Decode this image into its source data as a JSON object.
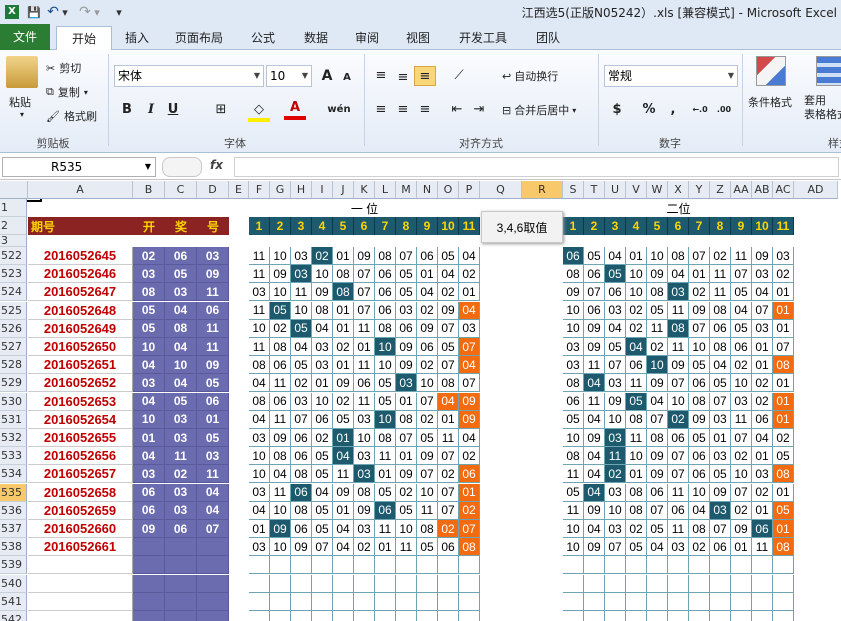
{
  "window": {
    "title": "江西选5(正版N05242）.xls  [兼容模式]  -  Microsoft Excel"
  },
  "qat": {
    "save": "💾",
    "undo": "↶",
    "undo_drop": "▾",
    "redo": "↷",
    "redo_drop": "▾",
    "customize": "▾"
  },
  "tabs": [
    "文件",
    "开始",
    "插入",
    "页面布局",
    "公式",
    "数据",
    "审阅",
    "视图",
    "开发工具",
    "团队"
  ],
  "ribbon": {
    "clipboard": {
      "label": "剪贴板",
      "paste": "粘贴",
      "cut": "剪切",
      "copy": "复制",
      "painter": "格式刷"
    },
    "font": {
      "label": "字体",
      "name": "宋体",
      "size": "10",
      "bold": "B",
      "italic": "I",
      "underline": "U",
      "grow": "A",
      "shrink": "A",
      "color": "A",
      "wen": "wén"
    },
    "align": {
      "label": "对齐方式",
      "wrap": "自动换行",
      "merge": "合并后居中"
    },
    "number": {
      "label": "数字",
      "format": "常规",
      "currency": "$",
      "percent": "%",
      "comma": ",",
      "inc": "←.0",
      "dec": ".00"
    },
    "styles": {
      "cond": "条件格式",
      "table": "套用\n表格格式",
      "cell": "样式"
    }
  },
  "formula_bar": {
    "name_box": "R535",
    "fx": "fx",
    "value": ""
  },
  "columns": [
    "A",
    "B",
    "C",
    "D",
    "E",
    "F",
    "G",
    "H",
    "I",
    "J",
    "K",
    "L",
    "M",
    "N",
    "O",
    "P",
    "Q",
    "R",
    "S",
    "T",
    "U",
    "V",
    "W",
    "X",
    "Y",
    "Z",
    "AA",
    "AB",
    "AC",
    "AD"
  ],
  "selected_col": "R",
  "sheet": {
    "header_row1": {
      "pos1": "一 位",
      "pos2": "二位"
    },
    "header_row2": {
      "qihao": "期号",
      "kai": "开",
      "jiang": "奖",
      "hao": "号",
      "nums": [
        "1",
        "2",
        "3",
        "4",
        "5",
        "6",
        "7",
        "8",
        "9",
        "10",
        "11"
      ]
    },
    "note": "3,4,6取值",
    "row_numbers": [
      "1",
      "2",
      "3",
      "522",
      "523",
      "524",
      "525",
      "526",
      "527",
      "528",
      "529",
      "530",
      "531",
      "532",
      "533",
      "534",
      "535",
      "536",
      "537",
      "538",
      "539",
      "540",
      "541",
      "542"
    ],
    "selected_row": "535",
    "data_rows": [
      {
        "id": "2016052645",
        "draw": [
          "02",
          "06",
          "03"
        ],
        "g1": [
          "11",
          "10",
          "03",
          "02",
          "01",
          "09",
          "08",
          "07",
          "06",
          "05",
          "04"
        ],
        "g2": [
          "06",
          "05",
          "04",
          "01",
          "10",
          "08",
          "07",
          "02",
          "11",
          "09",
          "03"
        ]
      },
      {
        "id": "2016052646",
        "draw": [
          "03",
          "05",
          "09"
        ],
        "g1": [
          "11",
          "09",
          "03",
          "10",
          "08",
          "07",
          "06",
          "05",
          "01",
          "04",
          "02"
        ],
        "g2": [
          "08",
          "06",
          "05",
          "10",
          "09",
          "04",
          "01",
          "11",
          "07",
          "03",
          "02"
        ]
      },
      {
        "id": "2016052647",
        "draw": [
          "08",
          "03",
          "11"
        ],
        "g1": [
          "03",
          "10",
          "11",
          "09",
          "08",
          "07",
          "06",
          "05",
          "04",
          "02",
          "01"
        ],
        "g2": [
          "09",
          "07",
          "06",
          "10",
          "08",
          "03",
          "02",
          "11",
          "05",
          "04",
          "01"
        ]
      },
      {
        "id": "2016052648",
        "draw": [
          "05",
          "04",
          "06"
        ],
        "g1": [
          "11",
          "05",
          "10",
          "08",
          "01",
          "07",
          "06",
          "03",
          "02",
          "09",
          "04"
        ],
        "g2": [
          "10",
          "06",
          "03",
          "02",
          "05",
          "11",
          "09",
          "08",
          "04",
          "07",
          "01"
        ]
      },
      {
        "id": "2016052649",
        "draw": [
          "05",
          "08",
          "11"
        ],
        "g1": [
          "10",
          "02",
          "05",
          "04",
          "01",
          "11",
          "08",
          "06",
          "09",
          "07",
          "03"
        ],
        "g2": [
          "10",
          "09",
          "04",
          "02",
          "11",
          "08",
          "07",
          "06",
          "05",
          "03",
          "01"
        ]
      },
      {
        "id": "2016052650",
        "draw": [
          "10",
          "04",
          "11"
        ],
        "g1": [
          "11",
          "08",
          "04",
          "03",
          "02",
          "01",
          "10",
          "09",
          "06",
          "05",
          "07"
        ],
        "g2": [
          "03",
          "09",
          "05",
          "04",
          "02",
          "11",
          "10",
          "08",
          "06",
          "01",
          "07"
        ]
      },
      {
        "id": "2016052651",
        "draw": [
          "04",
          "10",
          "09"
        ],
        "g1": [
          "08",
          "06",
          "05",
          "03",
          "01",
          "11",
          "10",
          "09",
          "02",
          "07",
          "04"
        ],
        "g2": [
          "03",
          "11",
          "07",
          "06",
          "10",
          "09",
          "05",
          "04",
          "02",
          "01",
          "08"
        ]
      },
      {
        "id": "2016052652",
        "draw": [
          "03",
          "04",
          "05"
        ],
        "g1": [
          "04",
          "11",
          "02",
          "01",
          "09",
          "06",
          "05",
          "03",
          "10",
          "08",
          "07"
        ],
        "g2": [
          "08",
          "04",
          "03",
          "11",
          "09",
          "07",
          "06",
          "05",
          "10",
          "02",
          "01"
        ]
      },
      {
        "id": "2016052653",
        "draw": [
          "04",
          "05",
          "06"
        ],
        "g1": [
          "08",
          "06",
          "03",
          "10",
          "02",
          "11",
          "05",
          "01",
          "07",
          "04",
          "09"
        ],
        "g2": [
          "06",
          "11",
          "09",
          "05",
          "04",
          "10",
          "08",
          "07",
          "03",
          "02",
          "01"
        ]
      },
      {
        "id": "2016052654",
        "draw": [
          "10",
          "03",
          "01"
        ],
        "g1": [
          "04",
          "11",
          "07",
          "06",
          "05",
          "03",
          "10",
          "08",
          "02",
          "01",
          "09"
        ],
        "g2": [
          "05",
          "04",
          "10",
          "08",
          "07",
          "02",
          "09",
          "03",
          "11",
          "06",
          "01"
        ]
      },
      {
        "id": "2016052655",
        "draw": [
          "01",
          "03",
          "05"
        ],
        "g1": [
          "03",
          "09",
          "06",
          "02",
          "01",
          "10",
          "08",
          "07",
          "05",
          "11",
          "04"
        ],
        "g2": [
          "10",
          "09",
          "03",
          "11",
          "08",
          "06",
          "05",
          "01",
          "07",
          "04",
          "02"
        ]
      },
      {
        "id": "2016052656",
        "draw": [
          "04",
          "11",
          "03"
        ],
        "g1": [
          "10",
          "08",
          "06",
          "05",
          "04",
          "03",
          "11",
          "01",
          "09",
          "07",
          "02"
        ],
        "g2": [
          "08",
          "04",
          "11",
          "10",
          "09",
          "07",
          "06",
          "03",
          "02",
          "01",
          "05"
        ]
      },
      {
        "id": "2016052657",
        "draw": [
          "03",
          "02",
          "11"
        ],
        "g1": [
          "10",
          "04",
          "08",
          "05",
          "11",
          "03",
          "01",
          "09",
          "07",
          "02",
          "06"
        ],
        "g2": [
          "11",
          "04",
          "02",
          "01",
          "09",
          "07",
          "06",
          "05",
          "10",
          "03",
          "08"
        ]
      },
      {
        "id": "2016052658",
        "draw": [
          "06",
          "03",
          "04"
        ],
        "g1": [
          "03",
          "11",
          "06",
          "04",
          "09",
          "08",
          "05",
          "02",
          "10",
          "07",
          "01"
        ],
        "g2": [
          "05",
          "04",
          "03",
          "08",
          "06",
          "11",
          "10",
          "09",
          "07",
          "02",
          "01"
        ]
      },
      {
        "id": "2016052659",
        "draw": [
          "06",
          "03",
          "04"
        ],
        "g1": [
          "04",
          "10",
          "08",
          "05",
          "01",
          "09",
          "06",
          "05",
          "11",
          "07",
          "02"
        ],
        "g2": [
          "11",
          "09",
          "10",
          "08",
          "07",
          "06",
          "04",
          "03",
          "02",
          "01",
          "05"
        ]
      },
      {
        "id": "2016052660",
        "draw": [
          "09",
          "06",
          "07"
        ],
        "g1": [
          "01",
          "09",
          "06",
          "05",
          "04",
          "03",
          "11",
          "10",
          "08",
          "02",
          "07"
        ],
        "g2": [
          "10",
          "04",
          "03",
          "02",
          "05",
          "11",
          "08",
          "07",
          "09",
          "06",
          "01"
        ]
      },
      {
        "id": "2016052661",
        "draw": [
          "",
          "",
          ""
        ],
        "g1": [
          "03",
          "10",
          "09",
          "07",
          "04",
          "02",
          "01",
          "11",
          "05",
          "06",
          "08"
        ],
        "g2": [
          "10",
          "09",
          "07",
          "05",
          "04",
          "03",
          "02",
          "06",
          "01",
          "11",
          "08"
        ]
      }
    ],
    "hl1": [
      [
        3
      ],
      [
        2
      ],
      [
        4
      ],
      [
        1
      ],
      [
        2
      ],
      [
        6
      ],
      [],
      [
        7
      ],
      [],
      [
        6
      ],
      [
        4
      ],
      [
        4
      ],
      [
        5
      ],
      [
        2
      ],
      [
        6
      ],
      [
        1
      ],
      []
    ],
    "or1": [
      [],
      [],
      [],
      [
        10
      ],
      [],
      [
        10
      ],
      [
        10
      ],
      [],
      [
        9,
        10
      ],
      [
        10
      ],
      [],
      [],
      [
        10
      ],
      [
        10
      ],
      [
        10
      ],
      [
        9,
        10
      ],
      [
        10
      ]
    ],
    "hl2": [
      [
        0
      ],
      [
        2
      ],
      [
        5
      ],
      [],
      [
        5
      ],
      [
        3
      ],
      [
        4
      ],
      [
        1
      ],
      [
        3
      ],
      [
        5
      ],
      [
        2
      ],
      [
        2
      ],
      [
        2
      ],
      [
        1
      ],
      [
        7
      ],
      [
        9
      ],
      []
    ],
    "or2": [
      [],
      [],
      [],
      [
        10
      ],
      [],
      [],
      [
        10
      ],
      [],
      [
        10
      ],
      [
        10
      ],
      [],
      [],
      [
        10
      ],
      [],
      [
        10
      ],
      [
        10
      ],
      [
        10
      ]
    ],
    "colors": {
      "header_bg": "#8b2323",
      "header_yellow": "#ffd400",
      "draw_bg": "#6b6bb0",
      "num_head": "#1e5a6e",
      "highlight": "#1e5a6e",
      "orange": "#f26b11",
      "id_red": "#c00000",
      "ribbon_green": "#2a7d33"
    }
  }
}
